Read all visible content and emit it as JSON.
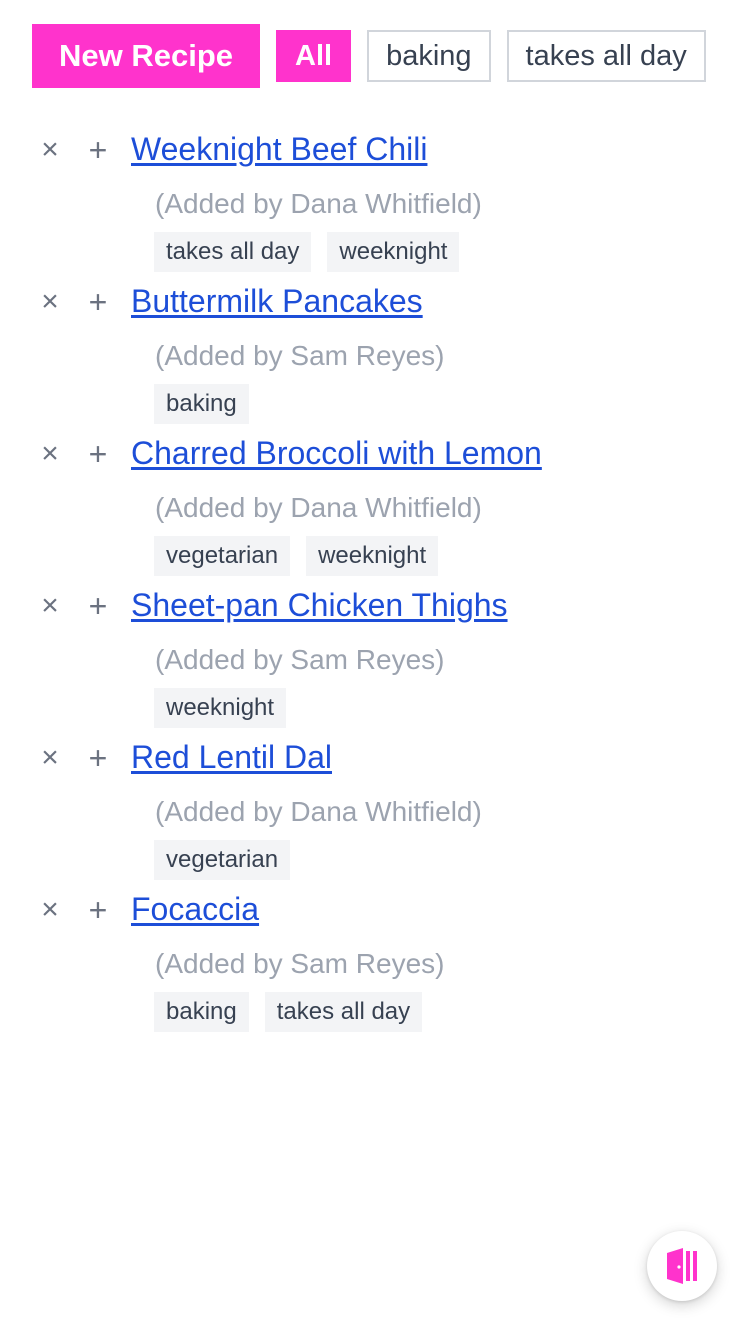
{
  "toolbar": {
    "new_recipe_label": "New Recipe",
    "filters": [
      "All",
      "baking",
      "takes all day",
      ""
    ],
    "active_filter": "All"
  },
  "recipes": [
    {
      "title": "Weeknight Beef Chili",
      "author": "(Added by Dana Whitfield)",
      "tags": [
        "takes all day",
        "weeknight"
      ]
    },
    {
      "title": "Buttermilk Pancakes",
      "author": "(Added by Sam Reyes)",
      "tags": [
        "baking"
      ]
    },
    {
      "title": "Charred Broccoli with Lemon",
      "author": "(Added by Dana Whitfield)",
      "tags": [
        "vegetarian",
        "weeknight"
      ]
    },
    {
      "title": "Sheet-pan Chicken Thighs",
      "author": "(Added by Sam Reyes)",
      "tags": [
        "weeknight"
      ]
    },
    {
      "title": "Red Lentil Dal",
      "author": "(Added by Dana Whitfield)",
      "tags": [
        "vegetarian"
      ]
    },
    {
      "title": "Focaccia",
      "author": "(Added by Sam Reyes)",
      "tags": [
        "baking",
        "takes all day"
      ]
    }
  ],
  "row_icons": {
    "remove": "×",
    "add": "+"
  },
  "fab": {
    "icon": "door-exit-icon"
  },
  "colors": {
    "accent": "#ff33cc",
    "link": "#1d4ed8",
    "muted": "#9ca3af",
    "tag_bg": "#f3f4f6"
  }
}
